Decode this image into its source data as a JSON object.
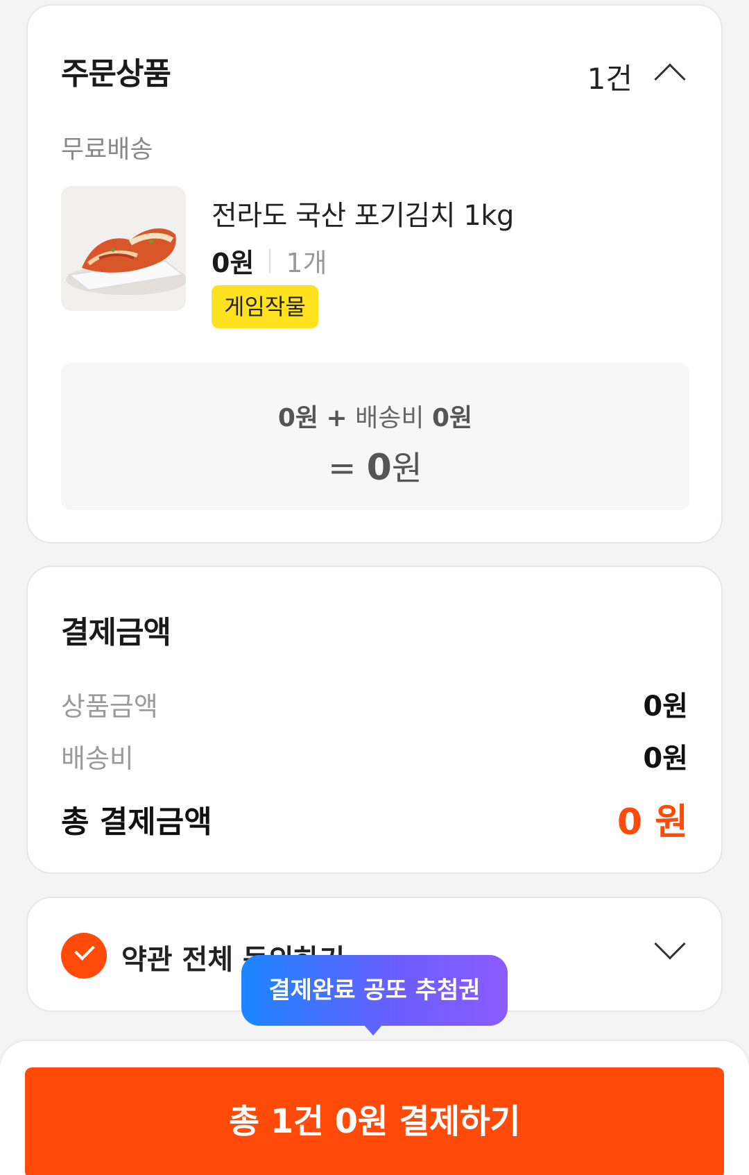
{
  "order": {
    "title": "주문상품",
    "count": "1건",
    "shipping_label": "무료배송",
    "product": {
      "name": "전라도 국산 포기김치 1kg",
      "price": "0원",
      "quantity": "1개",
      "tag": "게임작물"
    },
    "summary": {
      "goods": "0원",
      "plus": "+",
      "ship_label": "배송비",
      "ship": "0원",
      "equals": "=",
      "total_num": "0",
      "total_unit": "원"
    }
  },
  "payment": {
    "title": "결제금액",
    "goods_label": "상품금액",
    "goods_value": "0원",
    "ship_label": "배송비",
    "ship_value": "0원",
    "total_label": "총 결제금액",
    "total_value": "0 원"
  },
  "agree": {
    "label": "약관 전체 동의하기"
  },
  "tooltip": {
    "text": "결제완료 공또 추첨권"
  },
  "cta": {
    "label": "총 1건 0원 결제하기"
  },
  "colors": {
    "accent": "#ff4b0a",
    "tag_bg": "#ffe21f",
    "tooltip_start": "#1a86ff",
    "tooltip_end": "#8a5cff"
  }
}
